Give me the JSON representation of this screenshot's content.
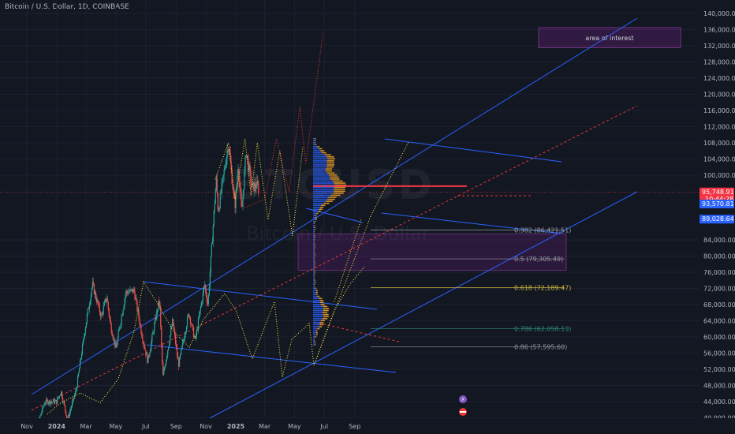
{
  "header": {
    "symbol_line": "Bitcoin / U.S. Dollar, 1D, COINBASE"
  },
  "watermark": {
    "symbol": "BTCUSD",
    "name": "Bitcoin / U.S. Dollar"
  },
  "chart_data": {
    "type": "line",
    "series_kind": "candlestick with drawing annotations",
    "y_axis": {
      "ticks": [
        "140,000.00",
        "136,000.00",
        "132,000.00",
        "128,000.00",
        "124,000.00",
        "120,000.00",
        "116,000.00",
        "112,000.00",
        "108,000.00",
        "104,000.00",
        "100,000.00",
        "84,000.00",
        "80,000.00",
        "76,000.00",
        "72,000.00",
        "68,000.00",
        "64,000.00",
        "60,000.00",
        "56,000.00",
        "52,000.00",
        "48,000.00",
        "44,000.00",
        "40,000.00"
      ],
      "tick_values": [
        140000,
        136000,
        132000,
        128000,
        124000,
        120000,
        116000,
        112000,
        108000,
        104000,
        100000,
        84000,
        80000,
        76000,
        72000,
        68000,
        64000,
        60000,
        56000,
        52000,
        48000,
        44000,
        40000
      ],
      "ylim": [
        40000,
        140000
      ]
    },
    "x_axis": {
      "ticks": [
        "Nov",
        "2024",
        "Mar",
        "May",
        "Jul",
        "Sep",
        "Nov",
        "2025",
        "Mar",
        "May",
        "Jul",
        "Sep"
      ],
      "tick_bold": [
        "2024",
        "2025"
      ],
      "xlim": [
        "2023-10-20",
        "2025-09-15"
      ]
    },
    "price_tags": [
      {
        "label": "95,748.91",
        "sub": "10:44:28",
        "value": 95748.91,
        "color": "#f23645"
      },
      {
        "label": "93,570.81",
        "value": 93570.81,
        "color": "#2962ff"
      },
      {
        "label": "89,028.64",
        "value": 89028.64,
        "color": "#2962ff"
      }
    ],
    "fib_levels": [
      {
        "label": "0.382 (86,421.51)",
        "value": 86421.51,
        "color": "#9598a1"
      },
      {
        "label": "0.5 (79,305.49)",
        "value": 79305.49,
        "color": "#9598a1"
      },
      {
        "label": "0.618 (72,189.47)",
        "value": 72189.47,
        "color": "#c9b23a"
      },
      {
        "label": "0.786 (62,058.19)",
        "value": 62058.19,
        "color": "#2e8b75"
      },
      {
        "label": "0.86 (57,595.60)",
        "value": 57595.6,
        "color": "#9598a1"
      }
    ],
    "annotation": {
      "label": "area of interest"
    },
    "price_path": [
      [
        "2023-11-01",
        35000
      ],
      [
        "2023-11-20",
        37500
      ],
      [
        "2023-12-08",
        44000
      ],
      [
        "2024-01-01",
        44000
      ],
      [
        "2024-01-10",
        46500
      ],
      [
        "2024-01-23",
        39500
      ],
      [
        "2024-02-10",
        47000
      ],
      [
        "2024-02-28",
        62000
      ],
      [
        "2024-03-14",
        73000
      ],
      [
        "2024-04-01",
        65000
      ],
      [
        "2024-04-12",
        70000
      ],
      [
        "2024-04-20",
        63000
      ],
      [
        "2024-05-01",
        57000
      ],
      [
        "2024-05-21",
        71000
      ],
      [
        "2024-06-07",
        71500
      ],
      [
        "2024-06-24",
        60000
      ],
      [
        "2024-07-05",
        54000
      ],
      [
        "2024-07-29",
        69500
      ],
      [
        "2024-08-05",
        50000
      ],
      [
        "2024-08-25",
        64000
      ],
      [
        "2024-09-06",
        53000
      ],
      [
        "2024-09-27",
        66000
      ],
      [
        "2024-10-10",
        59000
      ],
      [
        "2024-10-29",
        73000
      ],
      [
        "2024-11-05",
        68000
      ],
      [
        "2024-11-22",
        99000
      ],
      [
        "2024-11-26",
        91000
      ],
      [
        "2024-12-17",
        108000
      ],
      [
        "2024-12-30",
        92000
      ],
      [
        "2025-01-06",
        102500
      ],
      [
        "2025-01-13",
        90500
      ],
      [
        "2025-01-22",
        106000
      ],
      [
        "2025-02-03",
        97000
      ],
      [
        "2025-02-14",
        97500
      ],
      [
        "2025-02-18",
        95750
      ]
    ],
    "projection_yellow": [
      [
        "2024-11-20",
        99000
      ],
      [
        "2024-12-17",
        108000
      ],
      [
        "2024-12-31",
        94000
      ],
      [
        "2025-01-20",
        109000
      ],
      [
        "2025-02-01",
        95000
      ],
      [
        "2025-02-14",
        108000
      ],
      [
        "2025-03-08",
        89000
      ],
      [
        "2025-04-01",
        106000
      ],
      [
        "2025-04-27",
        85000
      ],
      [
        "2025-05-18",
        107000
      ]
    ],
    "projection_red": [
      [
        "2025-01-20",
        92000
      ],
      [
        "2025-03-01",
        94000
      ],
      [
        "2025-03-25",
        109000
      ],
      [
        "2025-04-20",
        96000
      ],
      [
        "2025-05-12",
        117000
      ],
      [
        "2025-05-24",
        103000
      ],
      [
        "2025-06-28",
        135000
      ]
    ]
  }
}
